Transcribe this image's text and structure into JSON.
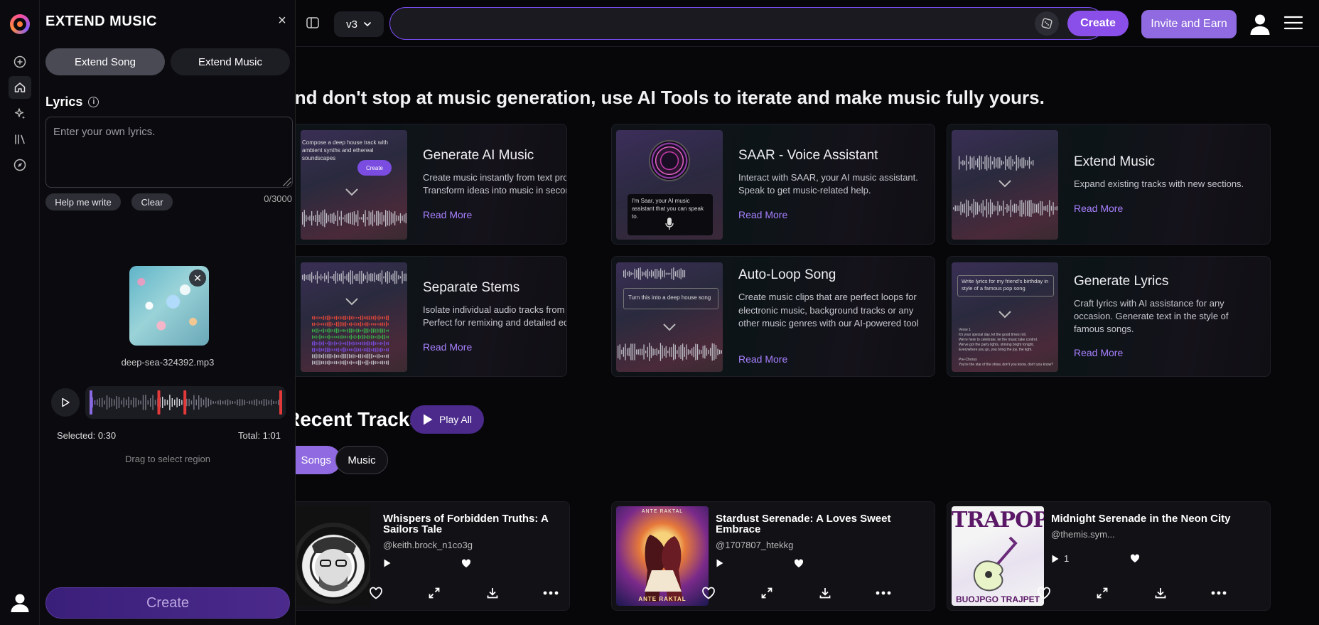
{
  "panel": {
    "title": "EXTEND MUSIC",
    "close_glyph": "×",
    "tab_extend_song": "Extend Song",
    "tab_extend_music": "Extend Music",
    "lyrics_label": "Lyrics",
    "lyrics_placeholder": "Enter your own lyrics.",
    "help_write": "Help me write",
    "clear": "Clear",
    "char_count": "0/3000",
    "file_name": "deep-sea-324392.mp3",
    "selected": "Selected: 0:30",
    "total": "Total: 1:01",
    "drag_hint": "Drag to select region",
    "selection_fraction": [
      0.36,
      0.49
    ],
    "create": "Create"
  },
  "topbar": {
    "version": "v3",
    "prompt_value": "",
    "create": "Create",
    "invite": "Invite and Earn"
  },
  "headline": "And don't stop at music generation, use AI Tools to iterate and make music fully yours.",
  "tools": [
    {
      "title": "Generate AI Music",
      "desc": "Create music instantly from text prompts. Transform ideas into music in seconds.",
      "link": "Read More",
      "thumb_text": "Compose a deep house track with ambient synths and ethereal soundscapes",
      "thumb_button": "Create"
    },
    {
      "title": "SAAR - Voice Assistant",
      "desc": "Interact with SAAR, your AI music assistant. Speak to get music-related help.",
      "link": "Read More",
      "thumb_text": "I'm Saar, your AI music assistant that you can speak to."
    },
    {
      "title": "Extend Music",
      "desc": "Expand existing tracks with new sections.",
      "link": "Read More"
    },
    {
      "title": "Separate Stems",
      "desc": "Isolate individual audio tracks from a mix. Perfect for remixing and detailed editing.",
      "link": "Read More"
    },
    {
      "title": "Auto-Loop Song",
      "desc": "Create music clips that are perfect loops for electronic music, background tracks or any other music genres with our AI-powered tool",
      "link": "Read More",
      "thumb_text": "Turn this into a deep house song"
    },
    {
      "title": "Generate Lyrics",
      "desc": "Craft lyrics with AI assistance for any occasion. Generate text in the style of famous songs.",
      "link": "Read More",
      "thumb_text": "Write lyrics for my friend's birthday in style of a famous pop song",
      "thumb_lyrics": "Verse 1\nIt's your special day, let the good times roll,\nWe're here to celebrate, let the music take control.\nWe've got the party lights, shining bright tonight,\nEverywhere you go, you bring the joy, the light.\n\nPre-Chorus\nYou're the star of the show, don't you know, don't you know?"
    }
  ],
  "recent": {
    "title": "Recent Tracks",
    "play_all": "Play All",
    "tab_songs": "Songs",
    "tab_music": "Music"
  },
  "tracks": [
    {
      "title": "Whispers of Forbidden Truths: A Sailors Tale",
      "user": "@keith.brock_n1co3g",
      "plays": ""
    },
    {
      "title": "Stardust Serenade: A Loves Sweet Embrace",
      "user": "@1707807_htekkg",
      "plays": "",
      "art_text": "ANTE RAKTAL",
      "art_text2": "ANTE RAKTAL"
    },
    {
      "title": "Midnight Serenade in the Neon City",
      "user": "@themis.sym...",
      "plays": "1",
      "art_top": "TRAPOP",
      "art_bottom": "BUOJPGO TRAJPET"
    }
  ],
  "icons": {
    "rail": [
      "create-plus-icon",
      "home-icon",
      "sparkle-icon",
      "library-icon",
      "explore-compass-icon",
      "user-avatar-icon"
    ],
    "accent": "#8a4fe8",
    "link": "#a880ff"
  }
}
